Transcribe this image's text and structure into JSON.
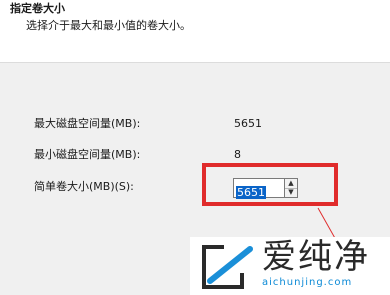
{
  "header": {
    "title": "指定卷大小",
    "subtitle": "选择介于最大和最小值的卷大小。"
  },
  "fields": {
    "max_label": "最大磁盘空间量(MB):",
    "max_value": "5651",
    "min_label": "最小磁盘空间量(MB):",
    "min_value": "8",
    "custom_label": "简单卷大小(MB)(S):",
    "custom_value": "5651"
  },
  "colors": {
    "highlight": "#e02b2b",
    "selection": "#0a64c8"
  },
  "watermark": {
    "brand": "爱纯净",
    "url": "aichunjing.com"
  }
}
